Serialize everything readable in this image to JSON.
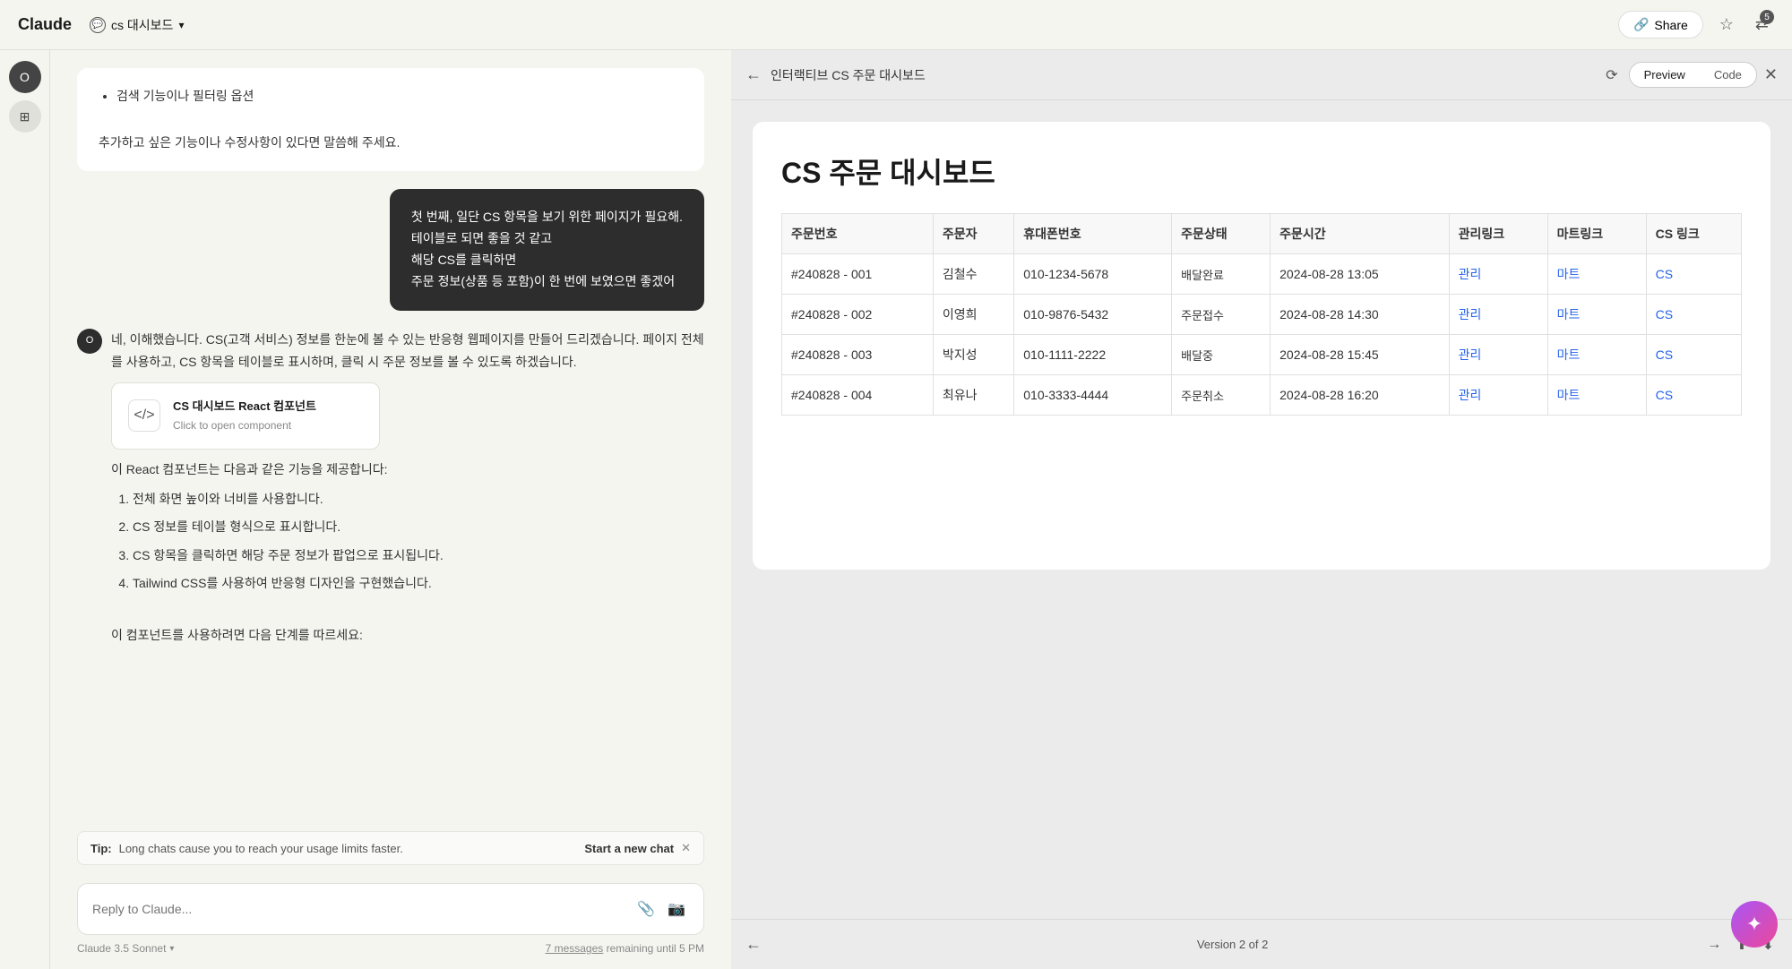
{
  "app": {
    "logo": "Claude",
    "chat_title": "cs 대시보드",
    "share_label": "Share"
  },
  "topbar": {
    "badge_count": "5"
  },
  "chat": {
    "system_message": {
      "bullet1": "검색 기능이나 필터링 옵션"
    },
    "system_followup": "추가하고 싶은 기능이나 수정사항이 있다면 말씀해 주세요.",
    "user_message": {
      "line1": "첫 번째, 일단 CS 항목을 보기 위한 페이지가 필요해.",
      "line2": "테이블로 되면 좋을 것 같고",
      "line3": "해당 CS를 클릭하면",
      "line4": "주문 정보(상품 등 포함)이 한 번에 보였으면 좋겠어"
    },
    "assistant_response1": {
      "intro": "네, 이해했습니다. CS(고객 서비스) 정보를 한눈에 볼 수 있는 반응형 웹페이지를 만들어 드리겠습니다. 페이지 전체를 사용하고, CS 항목을 테이블로 표시하며, 클릭 시 주문 정보를 볼 수 있도록 하겠습니다."
    },
    "code_card": {
      "icon": "</>",
      "title": "CS 대시보드 React 컴포넌트",
      "subtitle": "Click to open component"
    },
    "features": {
      "intro": "이 React 컴포넌트는 다음과 같은 기능을 제공합니다:",
      "items": [
        "전체 화면 높이와 너비를 사용합니다.",
        "CS 정보를 테이블 형식으로 표시합니다.",
        "CS 항목을 클릭하면 해당 주문 정보가 팝업으로 표시됩니다.",
        "Tailwind CSS를 사용하여 반응형 디자인을 구현했습니다."
      ],
      "outro": "이 컴포넌트를 사용하려면 다음 단계를 따르세요:"
    }
  },
  "tip": {
    "label": "Tip:",
    "message": "Long chats cause you to reach your usage limits faster.",
    "action": "Start a new chat"
  },
  "input": {
    "placeholder": "Reply to Claude...",
    "model": "Claude 3.5 Sonnet",
    "remaining_label": "7 messages",
    "remaining_suffix": " remaining until 5 PM"
  },
  "panel": {
    "back_icon": "←",
    "title": "인터랙티브 CS 주문 대시보드",
    "preview_label": "Preview",
    "code_label": "Code",
    "active_tab": "Preview",
    "close_icon": "✕",
    "refresh_icon": "⟳",
    "dashboard": {
      "title": "CS 주문 대시보드",
      "table": {
        "headers": [
          "주문번호",
          "주문자",
          "휴대폰번호",
          "주문상태",
          "주문시간",
          "관리링크",
          "마트링크",
          "CS 링크"
        ],
        "rows": [
          {
            "order_no": "#240828 - 001",
            "customer": "김철수",
            "phone": "010-1234-5678",
            "status": "배달완료",
            "time": "2024-08-28 13:05",
            "manage": "관리",
            "mart": "마트",
            "cs": "CS"
          },
          {
            "order_no": "#240828 - 002",
            "customer": "이영희",
            "phone": "010-9876-5432",
            "status": "주문접수",
            "time": "2024-08-28 14:30",
            "manage": "관리",
            "mart": "마트",
            "cs": "CS"
          },
          {
            "order_no": "#240828 - 003",
            "customer": "박지성",
            "phone": "010-1111-2222",
            "status": "배달중",
            "time": "2024-08-28 15:45",
            "manage": "관리",
            "mart": "마트",
            "cs": "CS"
          },
          {
            "order_no": "#240828 - 004",
            "customer": "최유나",
            "phone": "010-3333-4444",
            "status": "주문취소",
            "time": "2024-08-28 16:20",
            "manage": "관리",
            "mart": "마트",
            "cs": "CS"
          }
        ]
      }
    },
    "footer": {
      "version_text": "Version 2 of 2"
    }
  },
  "colors": {
    "link_blue": "#2563eb",
    "accent": "#a855f7"
  }
}
